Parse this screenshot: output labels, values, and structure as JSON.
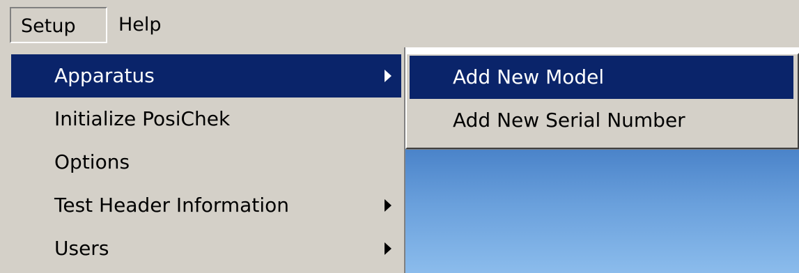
{
  "menubar": {
    "items": [
      {
        "label": "Setup"
      },
      {
        "label": "Help"
      }
    ]
  },
  "setup_menu": {
    "items": [
      {
        "label": "Apparatus",
        "has_submenu": true,
        "selected": true
      },
      {
        "label": "Initialize PosiChek",
        "has_submenu": false
      },
      {
        "label": "Options",
        "has_submenu": false
      },
      {
        "label": "Test Header Information",
        "has_submenu": true
      },
      {
        "label": "Users",
        "has_submenu": true
      }
    ]
  },
  "apparatus_submenu": {
    "items": [
      {
        "label": "Add New Model",
        "selected": true
      },
      {
        "label": "Add New Serial Number"
      }
    ]
  },
  "colors": {
    "menu_background": "#d4d0c8",
    "selection_background": "#0a246a",
    "selection_text": "#ffffff",
    "desktop_blue": "#6aa0dc"
  }
}
